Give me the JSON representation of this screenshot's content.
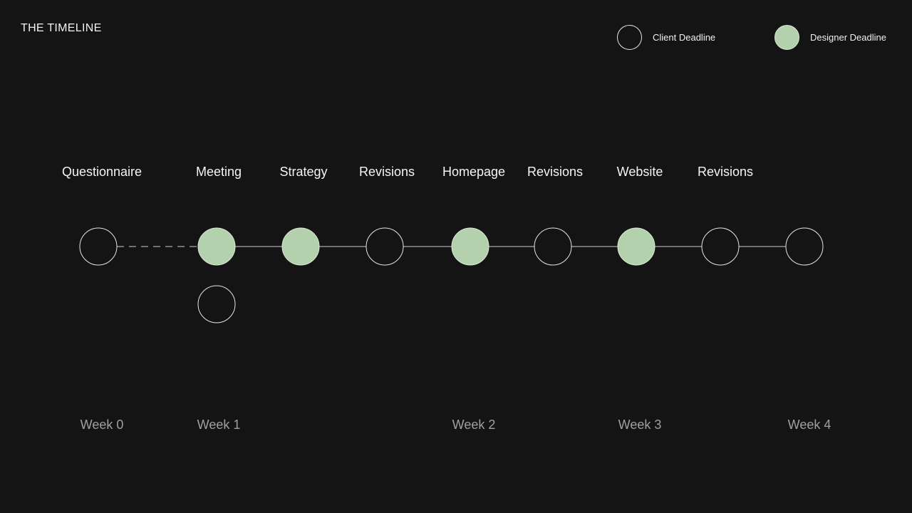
{
  "title": "THE TIMELINE",
  "colors": {
    "background": "#141414",
    "designer_fill": "#b3d1ad",
    "client_stroke": "#e6e6e6",
    "line": "#cfcfcf",
    "week_text": "#a0a0a0"
  },
  "legend": {
    "client": {
      "label": "Client Deadline",
      "style": "outline"
    },
    "designer": {
      "label": "Designer Deadline",
      "style": "filled"
    }
  },
  "milestones": [
    {
      "label": "Questionnaire",
      "type": "client"
    },
    {
      "label": "Meeting",
      "type": "designer"
    },
    {
      "label": "Strategy",
      "type": "designer"
    },
    {
      "label": "Revisions",
      "type": "client"
    },
    {
      "label": "Homepage",
      "type": "designer"
    },
    {
      "label": "Revisions",
      "type": "client"
    },
    {
      "label": "Website",
      "type": "designer"
    },
    {
      "label": "Revisions",
      "type": "client"
    },
    {
      "label": "",
      "type": "client"
    }
  ],
  "extra_nodes": [
    {
      "under_milestone": 1,
      "type": "client"
    }
  ],
  "connections": [
    {
      "from": 0,
      "to": 1,
      "style": "dashed"
    },
    {
      "from": 1,
      "to": 2,
      "style": "solid"
    },
    {
      "from": 2,
      "to": 3,
      "style": "solid"
    },
    {
      "from": 3,
      "to": 4,
      "style": "solid"
    },
    {
      "from": 4,
      "to": 5,
      "style": "solid"
    },
    {
      "from": 5,
      "to": 6,
      "style": "solid"
    },
    {
      "from": 6,
      "to": 7,
      "style": "solid"
    },
    {
      "from": 7,
      "to": 8,
      "style": "solid"
    }
  ],
  "weeks": [
    {
      "label": "Week 0",
      "at_milestone": 0
    },
    {
      "label": "Week 1",
      "at_milestone": 1
    },
    {
      "label": "Week 2",
      "at_milestone": 4
    },
    {
      "label": "Week 3",
      "at_milestone": 6
    },
    {
      "label": "Week 4",
      "at_milestone": 8
    }
  ]
}
